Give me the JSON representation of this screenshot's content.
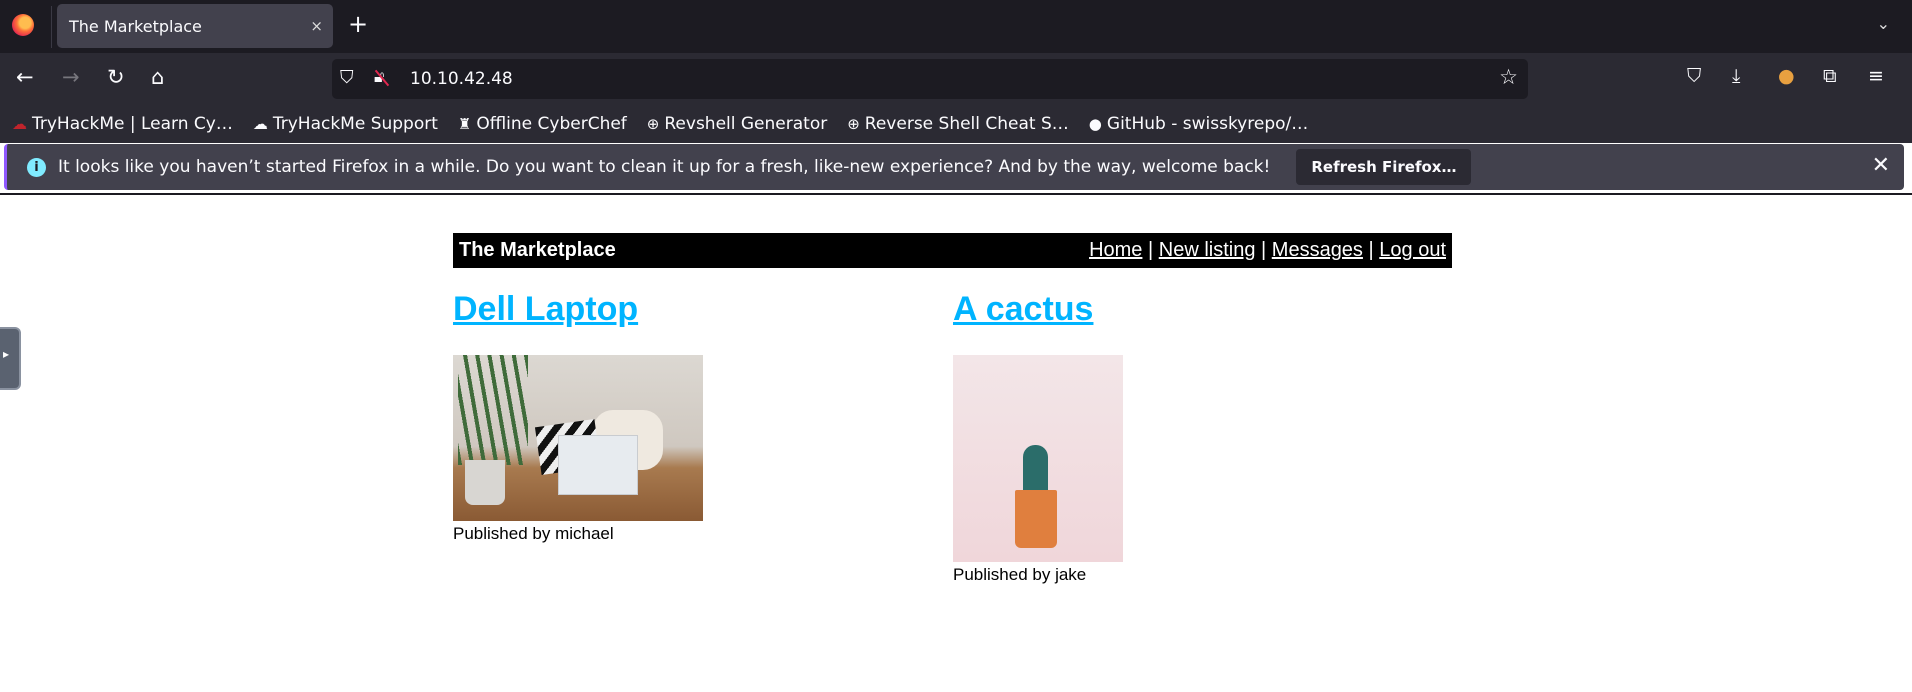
{
  "browser": {
    "tab_title": "The Marketplace",
    "tab_close": "×",
    "new_tab": "+",
    "url": "10.10.42.48",
    "bookmarks": [
      {
        "label": "TryHackMe | Learn Cy…",
        "icon": "cloud-icon"
      },
      {
        "label": "TryHackMe Support",
        "icon": "cloud-icon"
      },
      {
        "label": "Offline CyberChef",
        "icon": "chef-icon"
      },
      {
        "label": "Revshell Generator",
        "icon": "globe-icon"
      },
      {
        "label": "Reverse Shell Cheat S…",
        "icon": "globe-icon"
      },
      {
        "label": "GitHub - swisskyrepo/…",
        "icon": "github-icon"
      }
    ],
    "notification": {
      "message": "It looks like you haven’t started Firefox in a while. Do you want to clean it up for a fresh, like-new experience? And by the way, welcome back!",
      "button": "Refresh Firefox…"
    }
  },
  "page": {
    "site_title": "The Marketplace",
    "nav": [
      "Home",
      "New listing",
      "Messages",
      "Log out"
    ],
    "separator": "|",
    "listings": [
      {
        "title": "Dell Laptop",
        "published": "Published by michael"
      },
      {
        "title": "A cactus",
        "published": "Published by jake"
      }
    ],
    "link_color": "#00b4ff"
  }
}
